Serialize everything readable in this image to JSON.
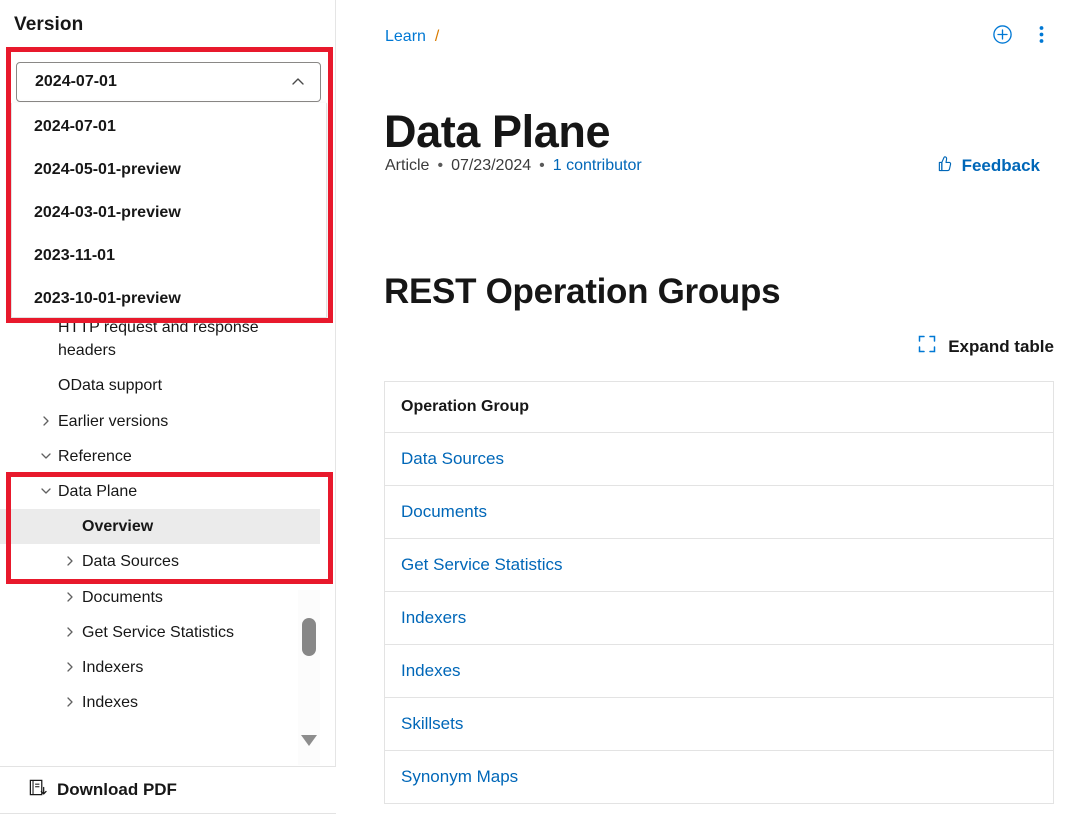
{
  "sidebar": {
    "version_label": "Version",
    "version_combo": {
      "value": "2024-07-01",
      "chevron_icon": "chevron-up-icon"
    },
    "version_options": [
      {
        "label": "2024-07-01"
      },
      {
        "label": "2024-05-01-preview"
      },
      {
        "label": "2024-03-01-preview"
      },
      {
        "label": "2023-11-01"
      },
      {
        "label": "2023-10-01-preview"
      }
    ],
    "nav_items": [
      {
        "label": "HTTP request and response headers",
        "level": 2,
        "chevron": "none",
        "selected": false
      },
      {
        "label": "OData support",
        "level": 2,
        "chevron": "none",
        "selected": false
      },
      {
        "label": "Earlier versions",
        "level": 1,
        "chevron": "collapsed",
        "selected": false
      },
      {
        "label": "Reference",
        "level": 1,
        "chevron": "expanded",
        "selected": false
      },
      {
        "label": "Data Plane",
        "level": 2,
        "chevron": "expanded",
        "selected": false
      },
      {
        "label": "Overview",
        "level": 3,
        "chevron": "none",
        "selected": true
      },
      {
        "label": "Data Sources",
        "level": 3,
        "chevron": "collapsed",
        "selected": false
      },
      {
        "label": "Documents",
        "level": 3,
        "chevron": "collapsed",
        "selected": false
      },
      {
        "label": "Get Service Statistics",
        "level": 3,
        "chevron": "collapsed",
        "selected": false
      },
      {
        "label": "Indexers",
        "level": 3,
        "chevron": "collapsed",
        "selected": false
      },
      {
        "label": "Indexes",
        "level": 3,
        "chevron": "collapsed",
        "selected": false
      }
    ],
    "download_pdf": {
      "label": "Download PDF",
      "icon": "pdf-download-icon"
    },
    "highlight_color": "#e8192c"
  },
  "main": {
    "breadcrumb": {
      "root": "Learn",
      "separator": "/"
    },
    "header_actions": {
      "add_icon": "circle-plus-icon",
      "more_icon": "more-vertical-icon"
    },
    "title": "Data Plane",
    "meta": {
      "type": "Article",
      "separator": "•",
      "date": "07/23/2024",
      "contributors": "1 contributor"
    },
    "feedback": {
      "label": "Feedback",
      "icon": "thumbs-up-icon"
    },
    "section_heading": "REST Operation Groups",
    "expand_table": {
      "label": "Expand table",
      "icon": "expand-icon"
    },
    "table": {
      "columns": [
        "Operation Group"
      ],
      "rows": [
        [
          "Data Sources"
        ],
        [
          "Documents"
        ],
        [
          "Get Service Statistics"
        ],
        [
          "Indexers"
        ],
        [
          "Indexes"
        ],
        [
          "Skillsets"
        ],
        [
          "Synonym Maps"
        ]
      ]
    },
    "link_color": "#0067b8"
  }
}
